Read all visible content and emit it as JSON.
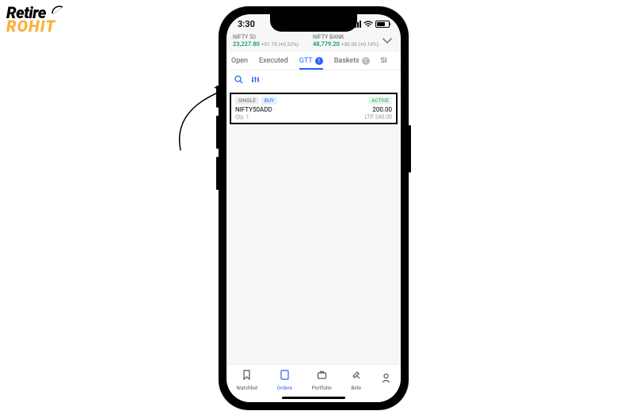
{
  "logo": {
    "line1": "Retire",
    "line2": "ROHIT"
  },
  "status_bar": {
    "time": "3:30"
  },
  "market": {
    "items": [
      {
        "label": "NIFTY 50",
        "price": "23,227.80",
        "change": "+51.75 (+0.22%)"
      },
      {
        "label": "NIFTY BANK",
        "price": "48,779.20",
        "change": "+50.05 (+0.10%)"
      }
    ]
  },
  "tabs": {
    "items": [
      {
        "label": "Open"
      },
      {
        "label": "Executed"
      },
      {
        "label": "GTT",
        "badge": "1"
      },
      {
        "label": "Baskets",
        "badge": "1"
      },
      {
        "label": "SI"
      }
    ]
  },
  "order": {
    "type_tag": "SINGLE",
    "side_tag": "BUY",
    "status_tag": "ACTIVE",
    "symbol": "NIFTY50ADD",
    "price": "200.00",
    "qty_label": "Qty. 1",
    "ltp_label": "LTP 240.00"
  },
  "bottom_nav": {
    "items": [
      {
        "label": "Watchlist"
      },
      {
        "label": "Orders"
      },
      {
        "label": "Portfolio"
      },
      {
        "label": "Bids"
      },
      {
        "label": ""
      }
    ]
  }
}
